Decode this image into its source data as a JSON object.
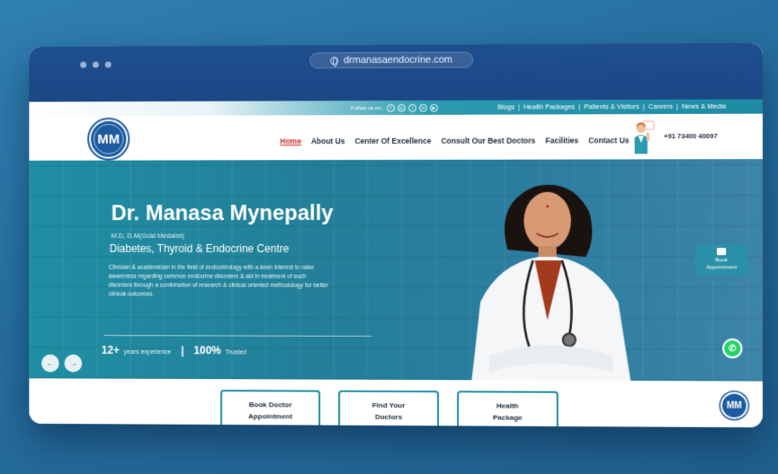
{
  "browser": {
    "url": "drmanasaendocrine.com"
  },
  "topbar": {
    "follow_label": "Follow us on :",
    "social_icons": [
      "facebook-icon",
      "instagram-icon",
      "twitter-icon",
      "linkedin-icon",
      "youtube-icon"
    ],
    "links": [
      "Blogs",
      "Health Packages",
      "Patients & Visitors",
      "Careers",
      "News & Media"
    ]
  },
  "header": {
    "logo_text": "MM",
    "nav": [
      "Home",
      "About Us",
      "Center Of Excellence",
      "Consult Our Best Doctors",
      "Facilities",
      "Contact Us"
    ],
    "active_nav": "Home",
    "phone": "+91 73400 40097"
  },
  "hero": {
    "name": "Dr. Manasa Mynepally",
    "degrees": "M.D, D.M(Gold Medalist)",
    "centre": "Diabetes, Thyroid & Endocrine Centre",
    "description": "Clinician & academician in the field of endocrinology with a keen interest to raise awareness regarding common endocrine disorders & aid in treatment of such disorders through a combination of research & clinical oriented methodology for better clinical outcomes.",
    "stat1_value": "12+",
    "stat1_label": "years experience",
    "stat2_value": "100%",
    "stat2_label": "Trusted",
    "prev": "←",
    "next": "→"
  },
  "side": {
    "book_label_1": "Book",
    "book_label_2": "Appointment"
  },
  "cards": [
    {
      "line1": "Book Doctor",
      "line2": "Appointment"
    },
    {
      "line1": "Find Your",
      "line2": "Doctors"
    },
    {
      "line1": "Health",
      "line2": "Package"
    }
  ],
  "colors": {
    "chrome": "#1f4f8f",
    "teal": "#1f8ea3",
    "active": "#d32f2f",
    "whatsapp": "#25d366"
  }
}
